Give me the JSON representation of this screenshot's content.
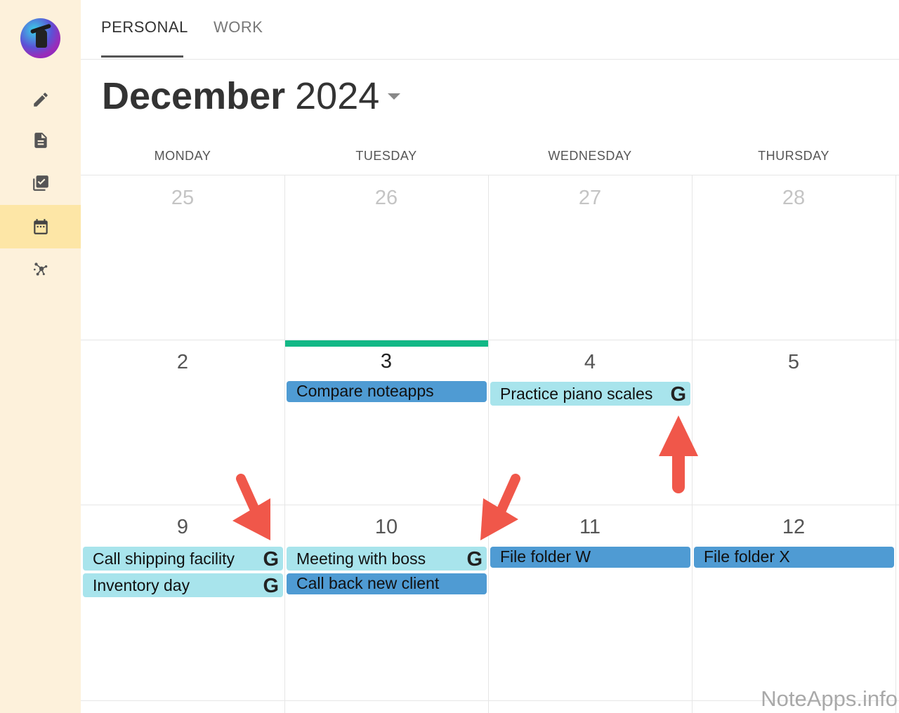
{
  "sidebar": {
    "icons": [
      "pencil-icon",
      "document-icon",
      "checklist-icon",
      "calendar-icon",
      "graph-icon"
    ],
    "active": "calendar-icon"
  },
  "tabs": [
    {
      "label": "PERSONAL",
      "active": true
    },
    {
      "label": "WORK",
      "active": false
    }
  ],
  "header": {
    "month": "December",
    "year": "2024"
  },
  "weekdays": [
    "MONDAY",
    "TUESDAY",
    "WEDNESDAY",
    "THURSDAY"
  ],
  "weeks": [
    {
      "days": [
        "25",
        "26",
        "27",
        "28"
      ]
    },
    {
      "days": [
        "2",
        "3",
        "4",
        "5"
      ]
    },
    {
      "days": [
        "9",
        "10",
        "11",
        "12"
      ]
    }
  ],
  "today": "3",
  "events": {
    "tue3_1": {
      "title": "Compare noteapps",
      "google": false
    },
    "wed4_1": {
      "title": "Practice piano scales",
      "google": true
    },
    "mon9_1": {
      "title": "Call shipping facility",
      "google": true
    },
    "mon9_2": {
      "title": "Inventory day",
      "google": true
    },
    "tue10_1": {
      "title": "Meeting with boss",
      "google": true
    },
    "tue10_2": {
      "title": "Call back new client",
      "google": false
    },
    "wed11_1": {
      "title": "File folder W",
      "google": false
    },
    "thu12_1": {
      "title": "File folder X",
      "google": false
    }
  },
  "google_glyph": "G",
  "colors": {
    "today_bar": "#12b886",
    "event_light": "#a8e4ec",
    "event_dark": "#4f9bd3",
    "arrow": "#f0574a",
    "sidebar": "#fdf1db",
    "sidebar_active": "#fde6a6"
  },
  "watermark": "NoteApps.info"
}
